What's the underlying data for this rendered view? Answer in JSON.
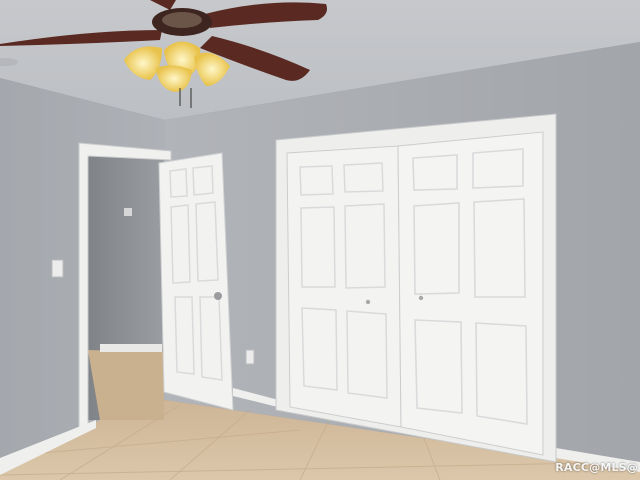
{
  "photo": {
    "watermark": "RACC@MLS@",
    "palette": {
      "wall": "#a9acb1",
      "ceiling": "#c2c4c8",
      "trim": "#f1f1ef",
      "floor_tile": "#d6c1a4",
      "fan_blade": "#5a2a22"
    }
  }
}
